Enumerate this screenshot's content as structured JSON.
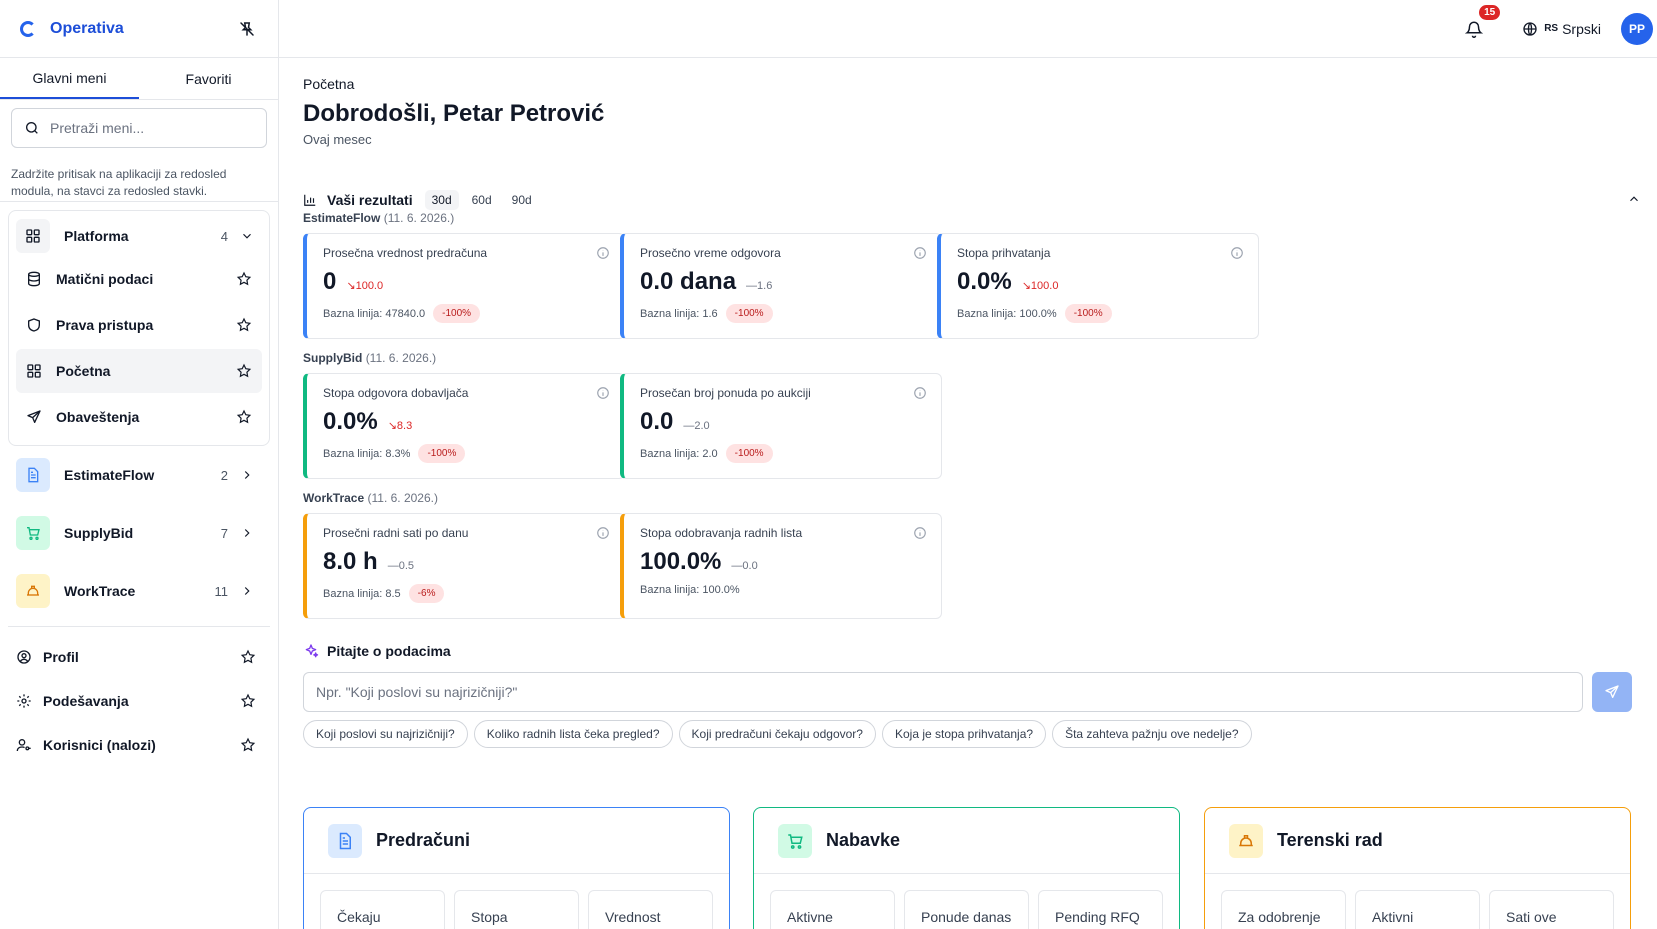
{
  "app": {
    "name": "Operativa"
  },
  "sidebar": {
    "tabs": [
      {
        "label": "Glavni meni"
      },
      {
        "label": "Favoriti"
      }
    ],
    "search_placeholder": "Pretraži meni...",
    "hint": "Zadržite pritisak na aplikaciji za redosled modula, na stavci za redosled stavki.",
    "platform": {
      "label": "Platforma",
      "count": "4",
      "items": [
        {
          "label": "Matični podaci",
          "icon": "database-icon"
        },
        {
          "label": "Prava pristupa",
          "icon": "shield-icon"
        },
        {
          "label": "Početna",
          "icon": "grid-icon"
        },
        {
          "label": "Obaveštenja",
          "icon": "send-icon"
        }
      ]
    },
    "groups": [
      {
        "label": "EstimateFlow",
        "count": "2",
        "icon": "document-icon",
        "color": "#3b82f6"
      },
      {
        "label": "SupplyBid",
        "count": "7",
        "icon": "cart-icon",
        "color": "#10b981"
      },
      {
        "label": "WorkTrace",
        "count": "11",
        "icon": "hardhat-icon",
        "color": "#f59e0b"
      }
    ],
    "bottom": [
      {
        "label": "Profil",
        "icon": "user-circle-icon"
      },
      {
        "label": "Podešavanja",
        "icon": "gear-icon"
      },
      {
        "label": "Korisnici (nalozi)",
        "icon": "users-key-icon"
      }
    ]
  },
  "topbar": {
    "notifications": "15",
    "lang_code": "RS",
    "lang_name": "Srpski",
    "avatar": "PP"
  },
  "main": {
    "breadcrumb": "Početna",
    "title": "Dobrodošli, Petar Petrović",
    "subtitle": "Ovaj mesec",
    "results_title": "Vaši rezultati",
    "ranges": [
      "30d",
      "60d",
      "90d"
    ],
    "sections": [
      {
        "name": "EstimateFlow",
        "date": "(11. 6. 2026.)"
      },
      {
        "name": "SupplyBid",
        "date": "(11. 6. 2026.)"
      },
      {
        "name": "WorkTrace",
        "date": "(11. 6. 2026.)"
      }
    ],
    "kpis": [
      {
        "title": "Prosečna vrednost predračuna",
        "value": "0",
        "delta": "100.0",
        "base": "Bazna linija: 47840.0",
        "pill": "-100%"
      },
      {
        "title": "Prosečno vreme odgovora",
        "value": "0.0 dana",
        "delta": "1.6",
        "base": "Bazna linija: 1.6",
        "pill": "-100%"
      },
      {
        "title": "Stopa prihvatanja",
        "value": "0.0%",
        "delta": "100.0",
        "base": "Bazna linija: 100.0%",
        "pill": "-100%"
      },
      {
        "title": "Stopa odgovora dobavljača",
        "value": "0.0%",
        "delta": "8.3",
        "base": "Bazna linija: 8.3%",
        "pill": "-100%"
      },
      {
        "title": "Prosečan broj ponuda po aukciji",
        "value": "0.0",
        "delta": "2.0",
        "base": "Bazna linija: 2.0",
        "pill": "-100%"
      },
      {
        "title": "Prosečni radni sati po danu",
        "value": "8.0 h",
        "delta": "0.5",
        "base": "Bazna linija: 8.5",
        "pill": "-6%"
      },
      {
        "title": "Stopa odobravanja radnih lista",
        "value": "100.0%",
        "delta": "0.0",
        "base": "Bazna linija: 100.0%"
      }
    ],
    "ask": {
      "title": "Pitajte o podacima",
      "placeholder": "Npr. \"Koji poslovi su najrizičniji?\"",
      "chips": [
        "Koji poslovi su najrizičniji?",
        "Koliko radnih lista čeka pregled?",
        "Koji predračuni čekaju odgovor?",
        "Koja je stopa prihvatanja?",
        "Šta zahteva pažnju ove nedelje?"
      ]
    },
    "modules": [
      {
        "title": "Predračuni",
        "stats": [
          "Čekaju",
          "Stopa",
          "Vrednost"
        ],
        "color": "#3b82f6"
      },
      {
        "title": "Nabavke",
        "stats": [
          "Aktivne",
          "Ponude danas",
          "Pending RFQ"
        ],
        "color": "#10b981"
      },
      {
        "title": "Terenski rad",
        "stats": [
          "Za odobrenje",
          "Aktivni",
          "Sati ove"
        ],
        "color": "#f59e0b"
      }
    ]
  }
}
